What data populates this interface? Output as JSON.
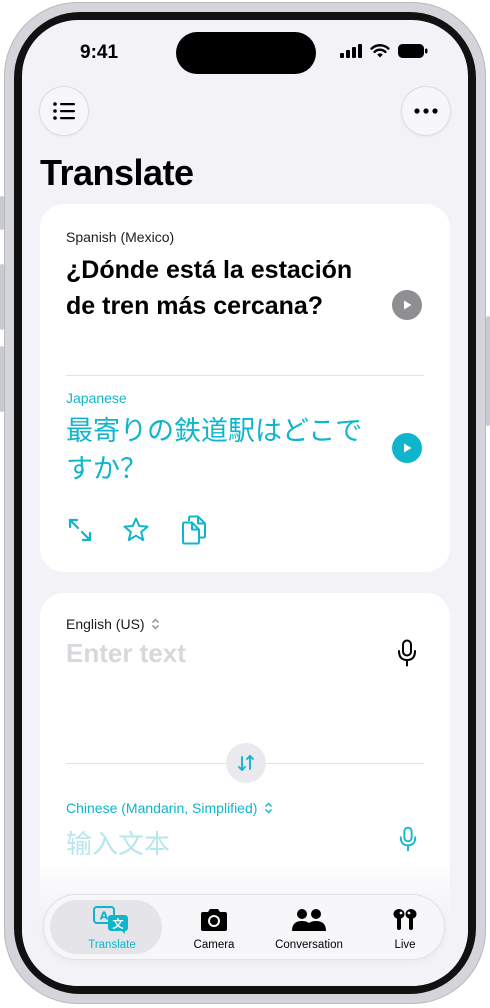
{
  "status_bar": {
    "time": "9:41"
  },
  "header": {
    "title": "Translate"
  },
  "source_card": {
    "source_language": "Spanish (Mexico)",
    "source_text": "¿Dónde está la estación de tren más cercana?",
    "target_language": "Japanese",
    "translated_text": "最寄りの鉄道駅はどこですか？"
  },
  "input_card": {
    "source_language": "English (US)",
    "source_placeholder": "Enter text",
    "target_language": "Chinese (Mandarin, Simplified)",
    "target_placeholder": "输入文本"
  },
  "tabbar": {
    "tabs": [
      {
        "label": "Translate",
        "icon": "translate-icon",
        "active": true
      },
      {
        "label": "Camera",
        "icon": "camera-icon",
        "active": false
      },
      {
        "label": "Conversation",
        "icon": "people-icon",
        "active": false
      },
      {
        "label": "Live",
        "icon": "airpods-icon",
        "active": false
      }
    ]
  },
  "colors": {
    "accent": "#0fb5cc",
    "background": "#f2f2f7",
    "card": "#ffffff",
    "secondary_icon": "#8e8e93"
  }
}
